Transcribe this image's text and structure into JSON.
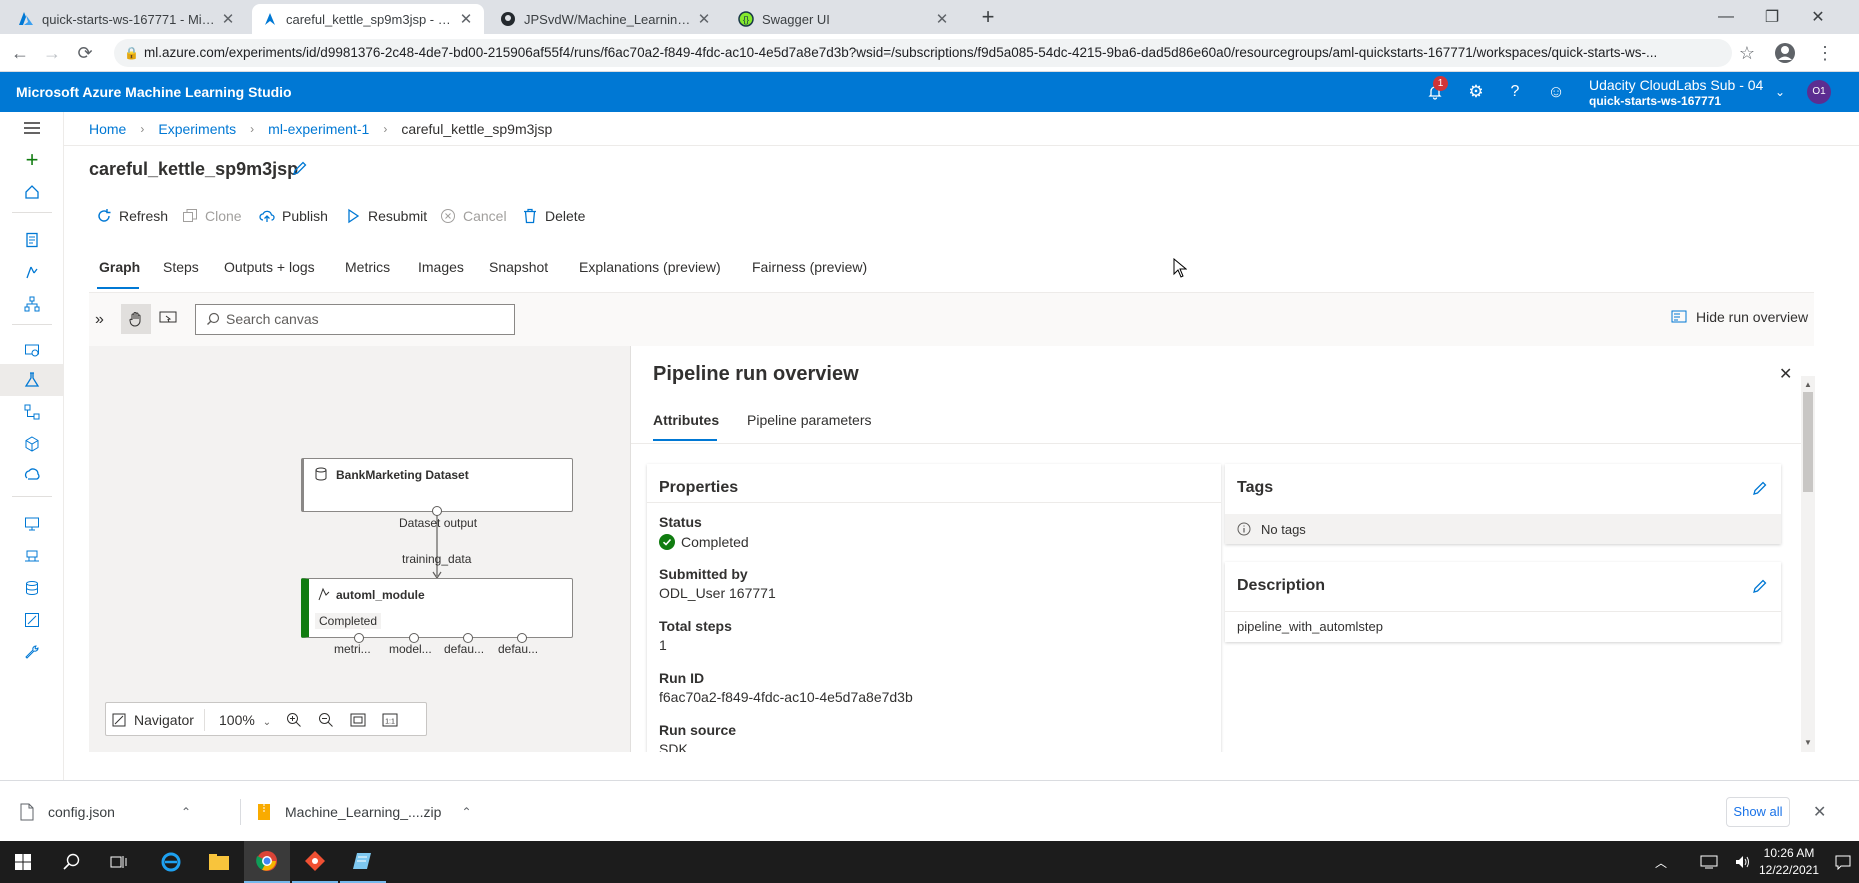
{
  "browser": {
    "tabs": [
      {
        "title": "quick-starts-ws-167771 - Microso",
        "icon": "azure-icon"
      },
      {
        "title": "careful_kettle_sp9m3jsp - Micros",
        "icon": "azure-ml-icon"
      },
      {
        "title": "JPSvdW/Machine_Learning_Engi",
        "icon": "github-icon"
      },
      {
        "title": "Swagger UI",
        "icon": "swagger-icon"
      }
    ],
    "new_tab": "+",
    "url": "ml.azure.com/experiments/id/d9981376-2c48-4de7-bd00-215906af55f4/runs/f6ac70a2-f849-4fdc-ac10-4e5d7a8e7d3b?wsid=/subscriptions/f9d5a085-54dc-4215-9ba6-dad5d86e60a0/resourcegroups/aml-quickstarts-167771/workspaces/quick-starts-ws-..."
  },
  "app": {
    "title": "Microsoft Azure Machine Learning Studio",
    "notification_count": "1",
    "account_name": "Udacity CloudLabs Sub - 04",
    "workspace": "quick-starts-ws-167771",
    "avatar_initials": "O1"
  },
  "breadcrumb": [
    "Home",
    "Experiments",
    "ml-experiment-1",
    "careful_kettle_sp9m3jsp"
  ],
  "page": {
    "title": "careful_kettle_sp9m3jsp"
  },
  "toolbar": {
    "refresh": "Refresh",
    "clone": "Clone",
    "publish": "Publish",
    "resubmit": "Resubmit",
    "cancel": "Cancel",
    "delete": "Delete"
  },
  "tabs": [
    "Graph",
    "Steps",
    "Outputs + logs",
    "Metrics",
    "Images",
    "Snapshot",
    "Explanations (preview)",
    "Fairness (preview)"
  ],
  "canvas": {
    "search_placeholder": "Search canvas",
    "hide_overview": "Hide run overview",
    "dataset_node": "BankMarketing Dataset",
    "dataset_output": "Dataset output",
    "edge_label": "training_data",
    "module_node": "automl_module",
    "module_status": "Completed",
    "ports": [
      "metri...",
      "model...",
      "defau...",
      "defau..."
    ],
    "navigator": "Navigator",
    "zoom": "100%"
  },
  "overview": {
    "title": "Pipeline run overview",
    "tabs": [
      "Attributes",
      "Pipeline parameters"
    ],
    "properties": {
      "heading": "Properties",
      "status_label": "Status",
      "status_value": "Completed",
      "submitted_by_label": "Submitted by",
      "submitted_by_value": "ODL_User 167771",
      "total_steps_label": "Total steps",
      "total_steps_value": "1",
      "run_id_label": "Run ID",
      "run_id_value": "f6ac70a2-f849-4fdc-ac10-4e5d7a8e7d3b",
      "run_source_label": "Run source",
      "run_source_value": "SDK"
    },
    "tags": {
      "heading": "Tags",
      "empty": "No tags"
    },
    "description": {
      "heading": "Description",
      "value": "pipeline_with_automlstep"
    }
  },
  "downloads": {
    "items": [
      "config.json",
      "Machine_Learning_....zip"
    ],
    "show_all": "Show all"
  },
  "taskbar": {
    "time": "10:26 AM",
    "date": "12/22/2021"
  },
  "colors": {
    "azure_blue": "#0078d4",
    "success_green": "#107c10",
    "taskbar": "#1c1c1c"
  }
}
